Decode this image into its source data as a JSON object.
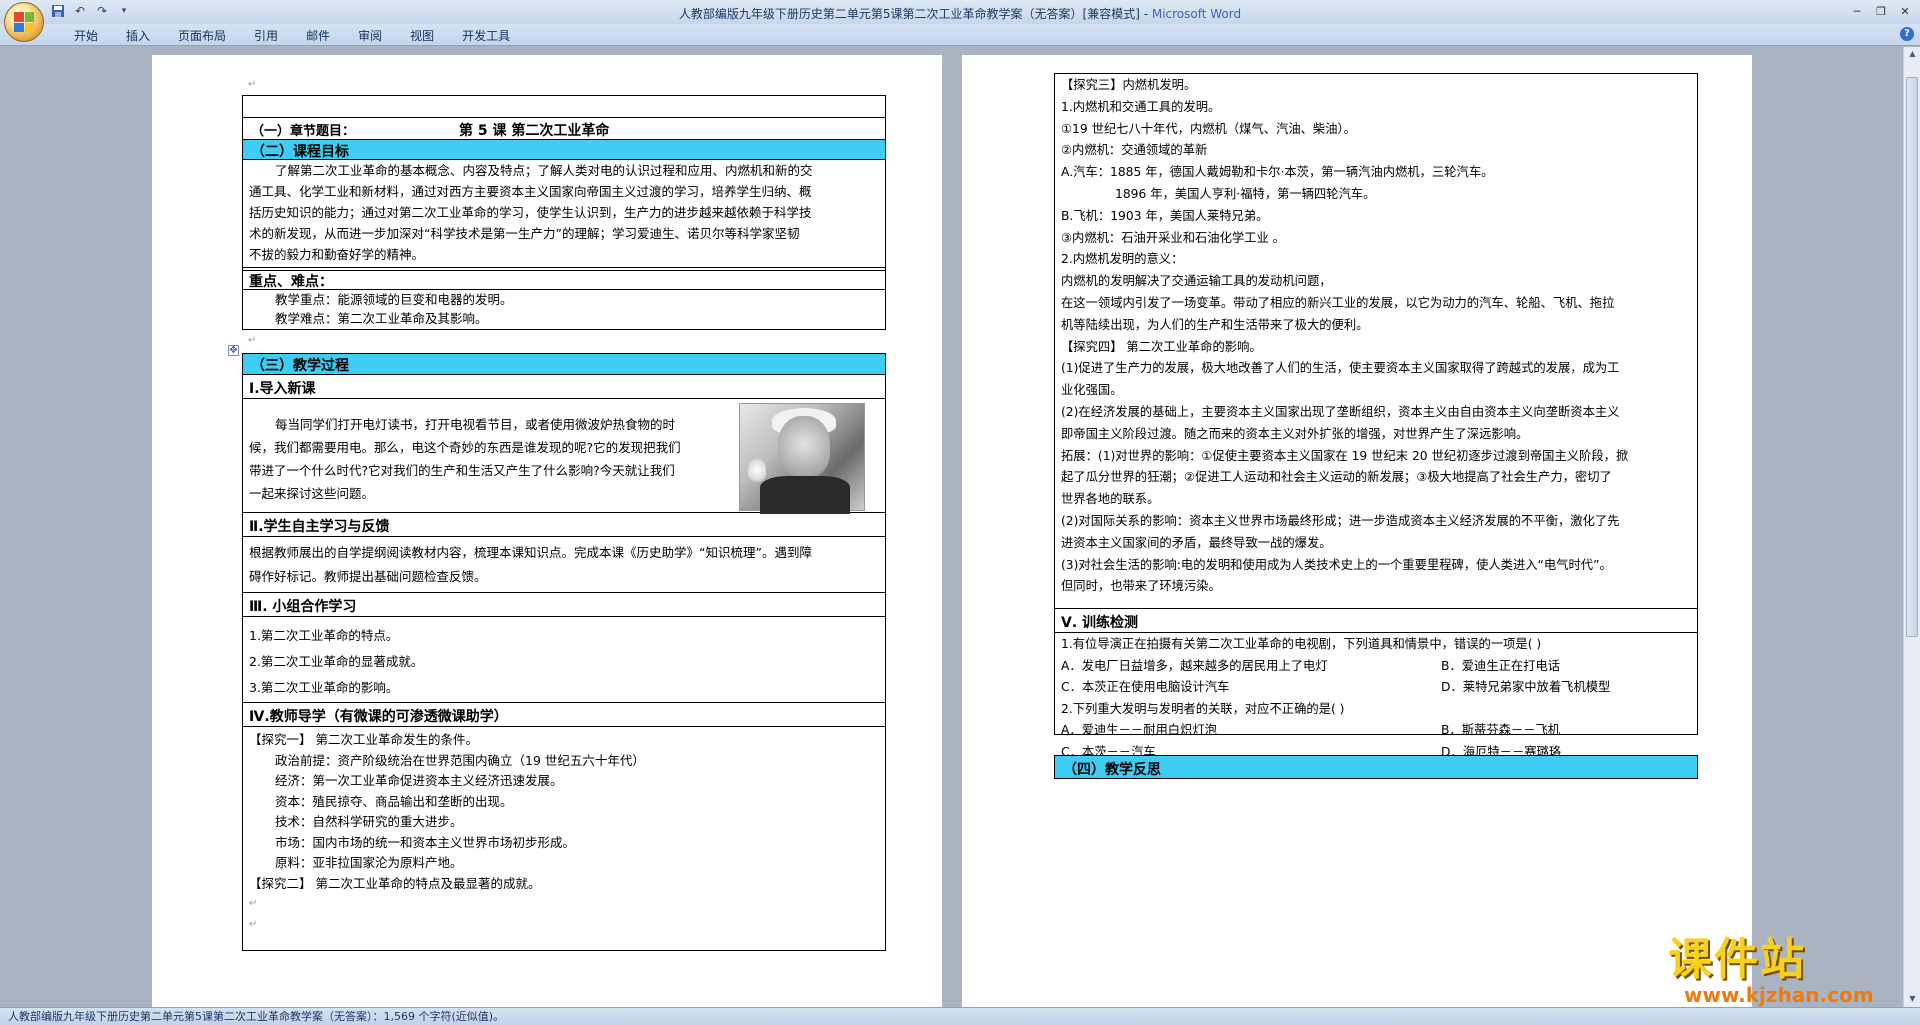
{
  "window": {
    "title": "人教部编版九年级下册历史第二单元第5课第二次工业革命教学案（无答案）[兼容模式] - ",
    "app_name": "Microsoft Word"
  },
  "ribbon": {
    "tabs": [
      "开始",
      "插入",
      "页面布局",
      "引用",
      "邮件",
      "审阅",
      "视图",
      "开发工具"
    ]
  },
  "status": {
    "text": "人教部编版九年级下册历史第二单元第5课第二次工业革命教学案（无答案）：1,569 个字符(近似值)。"
  },
  "page1": {
    "chapter_label": "（一）章节题目：",
    "chapter_title": "第 5 课  第二次工业革命",
    "goal_heading": "（二）课程目标",
    "goal_lines": [
      "了解第二次工业革命的基本概念、内容及特点；了解人类对电的认识过程和应用、内燃机和新的交",
      "通工具、化学工业和新材料，通过对西方主要资本主义国家向帝国主义过渡的学习，培养学生归纳、概",
      "括历史知识的能力；通过对第二次工业革命的学习，使学生认识到，生产力的进步越来越依赖于科学技",
      "术的新发现，从而进一步加深对“科学技术是第一生产力”的理解；学习爱迪生、诺贝尔等科学家坚韧",
      "不拔的毅力和勤奋好学的精神。"
    ],
    "key_heading": "重点、难点：",
    "key_point": "教学重点：能源领域的巨变和电器的发明。",
    "difficulty": "教学难点：第二次工业革命及其影响。",
    "process_heading": "（三）教学过程",
    "s1_heading": "Ⅰ.导入新课",
    "s1_lines": [
      "每当同学们打开电灯读书，打开电视看节目，或者使用微波炉热食物的时",
      "候，我们都需要用电。那么，电这个奇妙的东西是谁发现的呢?它的发现把我们",
      "带进了一个什么时代?它对我们的生产和生活又产生了什么影响?今天就让我们",
      "一起来探讨这些问题。"
    ],
    "s2_heading": "Ⅱ.学生自主学习与反馈",
    "s2_lines": [
      "根据教师展出的自学提纲阅读教材内容，梳理本课知识点。完成本课《历史助学》“知识梳理”。遇到障",
      "碍作好标记。教师提出基础问题检查反馈。"
    ],
    "s3_heading": "Ⅲ. 小组合作学习",
    "s3_items": [
      "1.第二次工业革命的特点。",
      "2.第二次工业革命的显著成就。",
      "3.第二次工业革命的影响。"
    ],
    "s4_heading": "Ⅳ.教师导学（有微课的可渗透微课助学）",
    "s4_lines": [
      "【探究一】  第二次工业革命发生的条件。",
      "政治前提：资产阶级统治在世界范围内确立（19 世纪五六十年代）",
      "经济：第一次工业革命促进资本主义经济迅速发展。",
      "资本：殖民掠夺、商品输出和垄断的出现。",
      "技术：自然科学研究的重大进步。",
      "市场：国内市场的统一和资本主义世界市场初步形成。",
      "原料：亚非拉国家沦为原料产地。",
      "【探究二】  第二次工业革命的特点及最显著的成就。"
    ]
  },
  "page2": {
    "e3_lines": [
      "【探究三】内燃机发明。",
      "1.内燃机和交通工具的发明。",
      "①19 世纪七八十年代，内燃机（煤气、汽油、柴油）。",
      "②内燃机：交通领域的革新",
      "A.汽车：1885 年，德国人戴姆勒和卡尔·本茨，第一辆汽油内燃机，三轮汽车。",
      "1896 年，美国人亨利·福特，第一辆四轮汽车。",
      "B.飞机：1903 年，美国人莱特兄弟。",
      "③内燃机：石油开采业和石油化学工业 。",
      "2.内燃机发明的意义：",
      "内燃机的发明解决了交通运输工具的发动机问题，",
      "在这一领域内引发了一场变革。带动了相应的新兴工业的发展，以它为动力的汽车、轮船、飞机、拖拉",
      "机等陆续出现，为人们的生产和生活带来了极大的便利。",
      "【探究四】  第二次工业革命的影响。",
      "(1)促进了生产力的发展，极大地改善了人们的生活，使主要资本主义国家取得了跨越式的发展，成为工",
      "业化强国。",
      "(2)在经济发展的基础上，主要资本主义国家出现了垄断组织，资本主义由自由资本主义向垄断资本主义",
      "即帝国主义阶段过渡。随之而来的资本主义对外扩张的增强，对世界产生了深远影响。",
      "拓展：(1)对世界的影响：①促使主要资本主义国家在 19 世纪末 20 世纪初逐步过渡到帝国主义阶段，掀",
      "起了瓜分世界的狂潮；②促进工人运动和社会主义运动的新发展；③极大地提高了社会生产力，密切了",
      "世界各地的联系。",
      "(2)对国际关系的影响：资本主义世界市场最终形成；进一步造成资本主义经济发展的不平衡，激化了先",
      "进资本主义国家间的矛盾，最终导致一战的爆发。",
      "(3)对社会生活的影响:电的发明和使用成为人类技术史上的一个重要里程碑，使人类进入“电气时代”。",
      "但同时，也带来了环境污染。"
    ],
    "s5_heading": "Ⅴ. 训练检测",
    "q1": "1.有位导演正在拍摄有关第二次工业革命的电视剧，下列道具和情景中，错误的一项是(      )",
    "q1_a": "A．发电厂日益增多，越来越多的居民用上了电灯",
    "q1_b": "B．爱迪生正在打电话",
    "q1_c": "C．本茨正在使用电脑设计汽车",
    "q1_d": "D．莱特兄弟家中放着飞机模型",
    "q2": "2.下列重大发明与发明者的关联，对应不正确的是(      )",
    "q2_a": "A．爱迪生－－耐用白炽灯泡",
    "q2_b": "B．斯蒂芬森－－飞机",
    "q2_c": "C．本茨－－汽车",
    "q2_d": "D．海厄特－－赛璐珞",
    "reflect_heading": "（四）教学反思"
  },
  "watermark": {
    "title": "课件站",
    "url": "www.kjzhan.com"
  },
  "colors": {
    "cyan_header": "#3ecdf4",
    "title_bar": "#c7d7ec"
  }
}
